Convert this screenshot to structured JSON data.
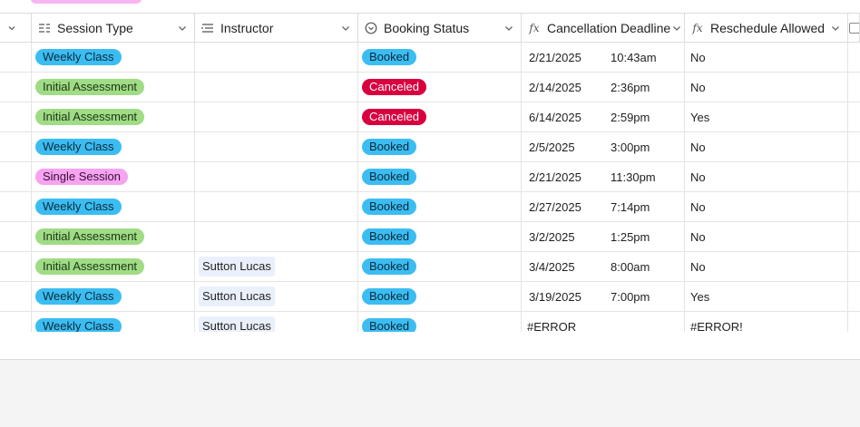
{
  "header": {
    "columns": [
      {
        "label": "Session Type",
        "icon": "multi-select-icon"
      },
      {
        "label": "Instructor",
        "icon": "list-icon"
      },
      {
        "label": "Booking Status",
        "icon": "circle-chevron-icon"
      },
      {
        "label": "Cancellation Deadline",
        "icon": "formula-icon"
      },
      {
        "label": "Reschedule Allowed",
        "icon": "formula-icon"
      }
    ],
    "fx_symbol": "fx"
  },
  "rows": [
    {
      "session_type": "Weekly Class",
      "session_kind": "weekly",
      "instructor": "",
      "status": "Booked",
      "status_kind": "booked",
      "date": "2/21/2025",
      "time": "10:43am",
      "reschedule": "No"
    },
    {
      "session_type": "Initial Assessment",
      "session_kind": "initial",
      "instructor": "",
      "status": "Canceled",
      "status_kind": "canceled",
      "date": "2/14/2025",
      "time": "2:36pm",
      "reschedule": "No"
    },
    {
      "session_type": "Initial Assessment",
      "session_kind": "initial",
      "instructor": "",
      "status": "Canceled",
      "status_kind": "canceled",
      "date": "6/14/2025",
      "time": "2:59pm",
      "reschedule": "Yes"
    },
    {
      "session_type": "Weekly Class",
      "session_kind": "weekly",
      "instructor": "",
      "status": "Booked",
      "status_kind": "booked",
      "date": "2/5/2025",
      "time": "3:00pm",
      "reschedule": "No"
    },
    {
      "session_type": "Single Session",
      "session_kind": "single",
      "instructor": "",
      "status": "Booked",
      "status_kind": "booked",
      "date": "2/21/2025",
      "time": "11:30pm",
      "reschedule": "No"
    },
    {
      "session_type": "Weekly Class",
      "session_kind": "weekly",
      "instructor": "",
      "status": "Booked",
      "status_kind": "booked",
      "date": "2/27/2025",
      "time": "7:14pm",
      "reschedule": "No"
    },
    {
      "session_type": "Initial Assessment",
      "session_kind": "initial",
      "instructor": "",
      "status": "Booked",
      "status_kind": "booked",
      "date": "3/2/2025",
      "time": "1:25pm",
      "reschedule": "No"
    },
    {
      "session_type": "Initial Assessment",
      "session_kind": "initial",
      "instructor": "Sutton Lucas",
      "status": "Booked",
      "status_kind": "booked",
      "date": "3/4/2025",
      "time": "8:00am",
      "reschedule": "No"
    },
    {
      "session_type": "Weekly Class",
      "session_kind": "weekly",
      "instructor": "Sutton Lucas",
      "status": "Booked",
      "status_kind": "booked",
      "date": "3/19/2025",
      "time": "7:00pm",
      "reschedule": "Yes"
    },
    {
      "session_type": "Weekly Class",
      "session_kind": "weekly",
      "instructor": "Sutton Lucas",
      "status": "Booked",
      "status_kind": "booked",
      "date": "#ERROR",
      "time": "",
      "reschedule": "#ERROR!"
    }
  ],
  "colors": {
    "weekly": "#3bbdf2",
    "initial": "#9fdc85",
    "single": "#f6a3f0",
    "booked": "#3bbdf2",
    "canceled": "#d8003f",
    "instructor_chip": "#eaf0fb"
  }
}
